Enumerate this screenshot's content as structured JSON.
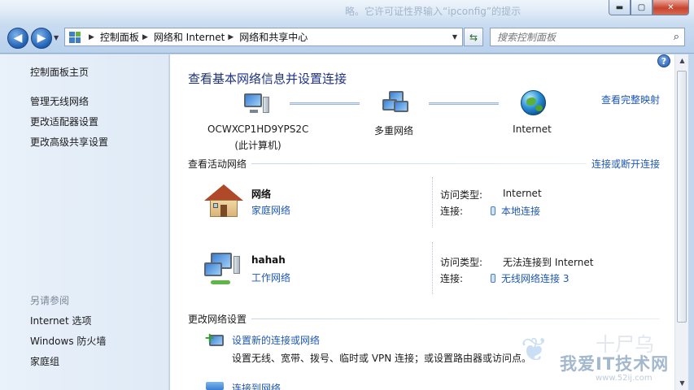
{
  "window": {
    "ghost_text": "略。它许可证性界输入“ipconfig”的提示",
    "buttons": {
      "minimize": "▬",
      "maximize": "▢",
      "close": "✕"
    }
  },
  "address_bar": {
    "breadcrumbs": [
      "控制面板",
      "网络和 Internet",
      "网络和共享中心"
    ]
  },
  "search": {
    "placeholder": "搜索控制面板"
  },
  "sidebar": {
    "items": [
      "控制面板主页",
      "管理无线网络",
      "更改适配器设置",
      "更改高级共享设置"
    ],
    "see_also_label": "另请参阅",
    "see_also": [
      "Internet 选项",
      "Windows 防火墙",
      "家庭组"
    ]
  },
  "main": {
    "title": "查看基本网络信息并设置连接",
    "view_map": "查看完整映射",
    "map_nodes": [
      {
        "name": "OCWXCP1HD9YPS2C",
        "sub": "(此计算机)"
      },
      {
        "name": "多重网络"
      },
      {
        "name": "Internet"
      }
    ],
    "active_networks": {
      "title": "查看活动网络",
      "connect_link": "连接或断开连接",
      "access_type_label": "访问类型:",
      "connection_label": "连接:",
      "networks": [
        {
          "name": "网络",
          "type": "家庭网络",
          "access": "Internet",
          "connection": "本地连接"
        },
        {
          "name": "hahah",
          "type": "工作网络",
          "access": "无法连接到 Internet",
          "connection": "无线网络连接 3"
        }
      ]
    },
    "change_settings": {
      "title": "更改网络设置",
      "task_link": "设置新的连接或网络",
      "task_desc": "设置无线、宽带、拨号、临时或 VPN 连接；或设置路由器或访问点。",
      "next_task_partial": "连接到网络"
    }
  },
  "watermark": {
    "brand": "我爱IT技术网",
    "url": "www.52ij.com",
    "big": "十尸乌"
  }
}
